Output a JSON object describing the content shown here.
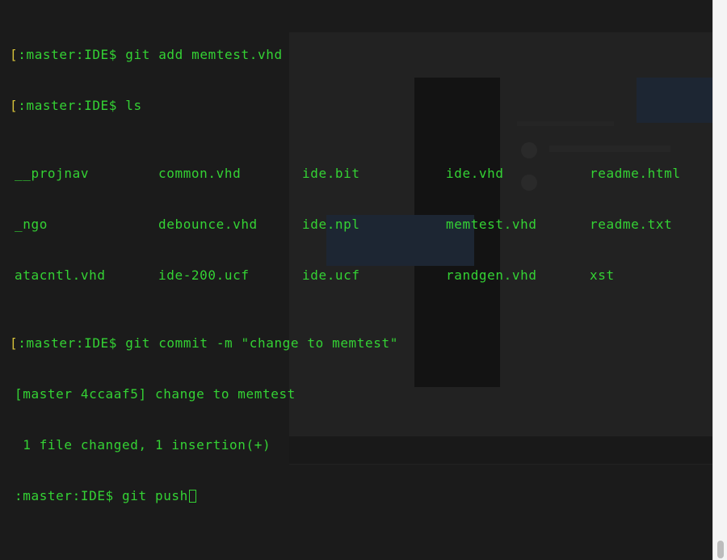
{
  "terminal": {
    "prompt_prefix": "[",
    "prompt": ":master:IDE$",
    "lines": [
      {
        "command": " git add memtest.vhd"
      },
      {
        "command": " ls"
      }
    ],
    "ls_output": [
      [
        "__projnav",
        "common.vhd",
        "ide.bit",
        "ide.vhd",
        "readme.html"
      ],
      [
        "_ngo",
        "debounce.vhd",
        "ide.npl",
        "memtest.vhd",
        "readme.txt"
      ],
      [
        "atacntl.vhd",
        "ide-200.ucf",
        "ide.ucf",
        "randgen.vhd",
        "xst"
      ]
    ],
    "commit_command": " git commit -m \"change to memtest\"",
    "commit_result": "[master 4ccaaf5] change to memtest",
    "commit_summary": " 1 file changed, 1 insertion(+)",
    "last_prompt": ":master:IDE$",
    "current_input": " git push"
  },
  "colors": {
    "terminal_bg": "#1b1b1b",
    "text_green": "#34d234",
    "bracket_yellow": "#d6c23a",
    "scrollbar_bg": "#f4f4f4"
  }
}
